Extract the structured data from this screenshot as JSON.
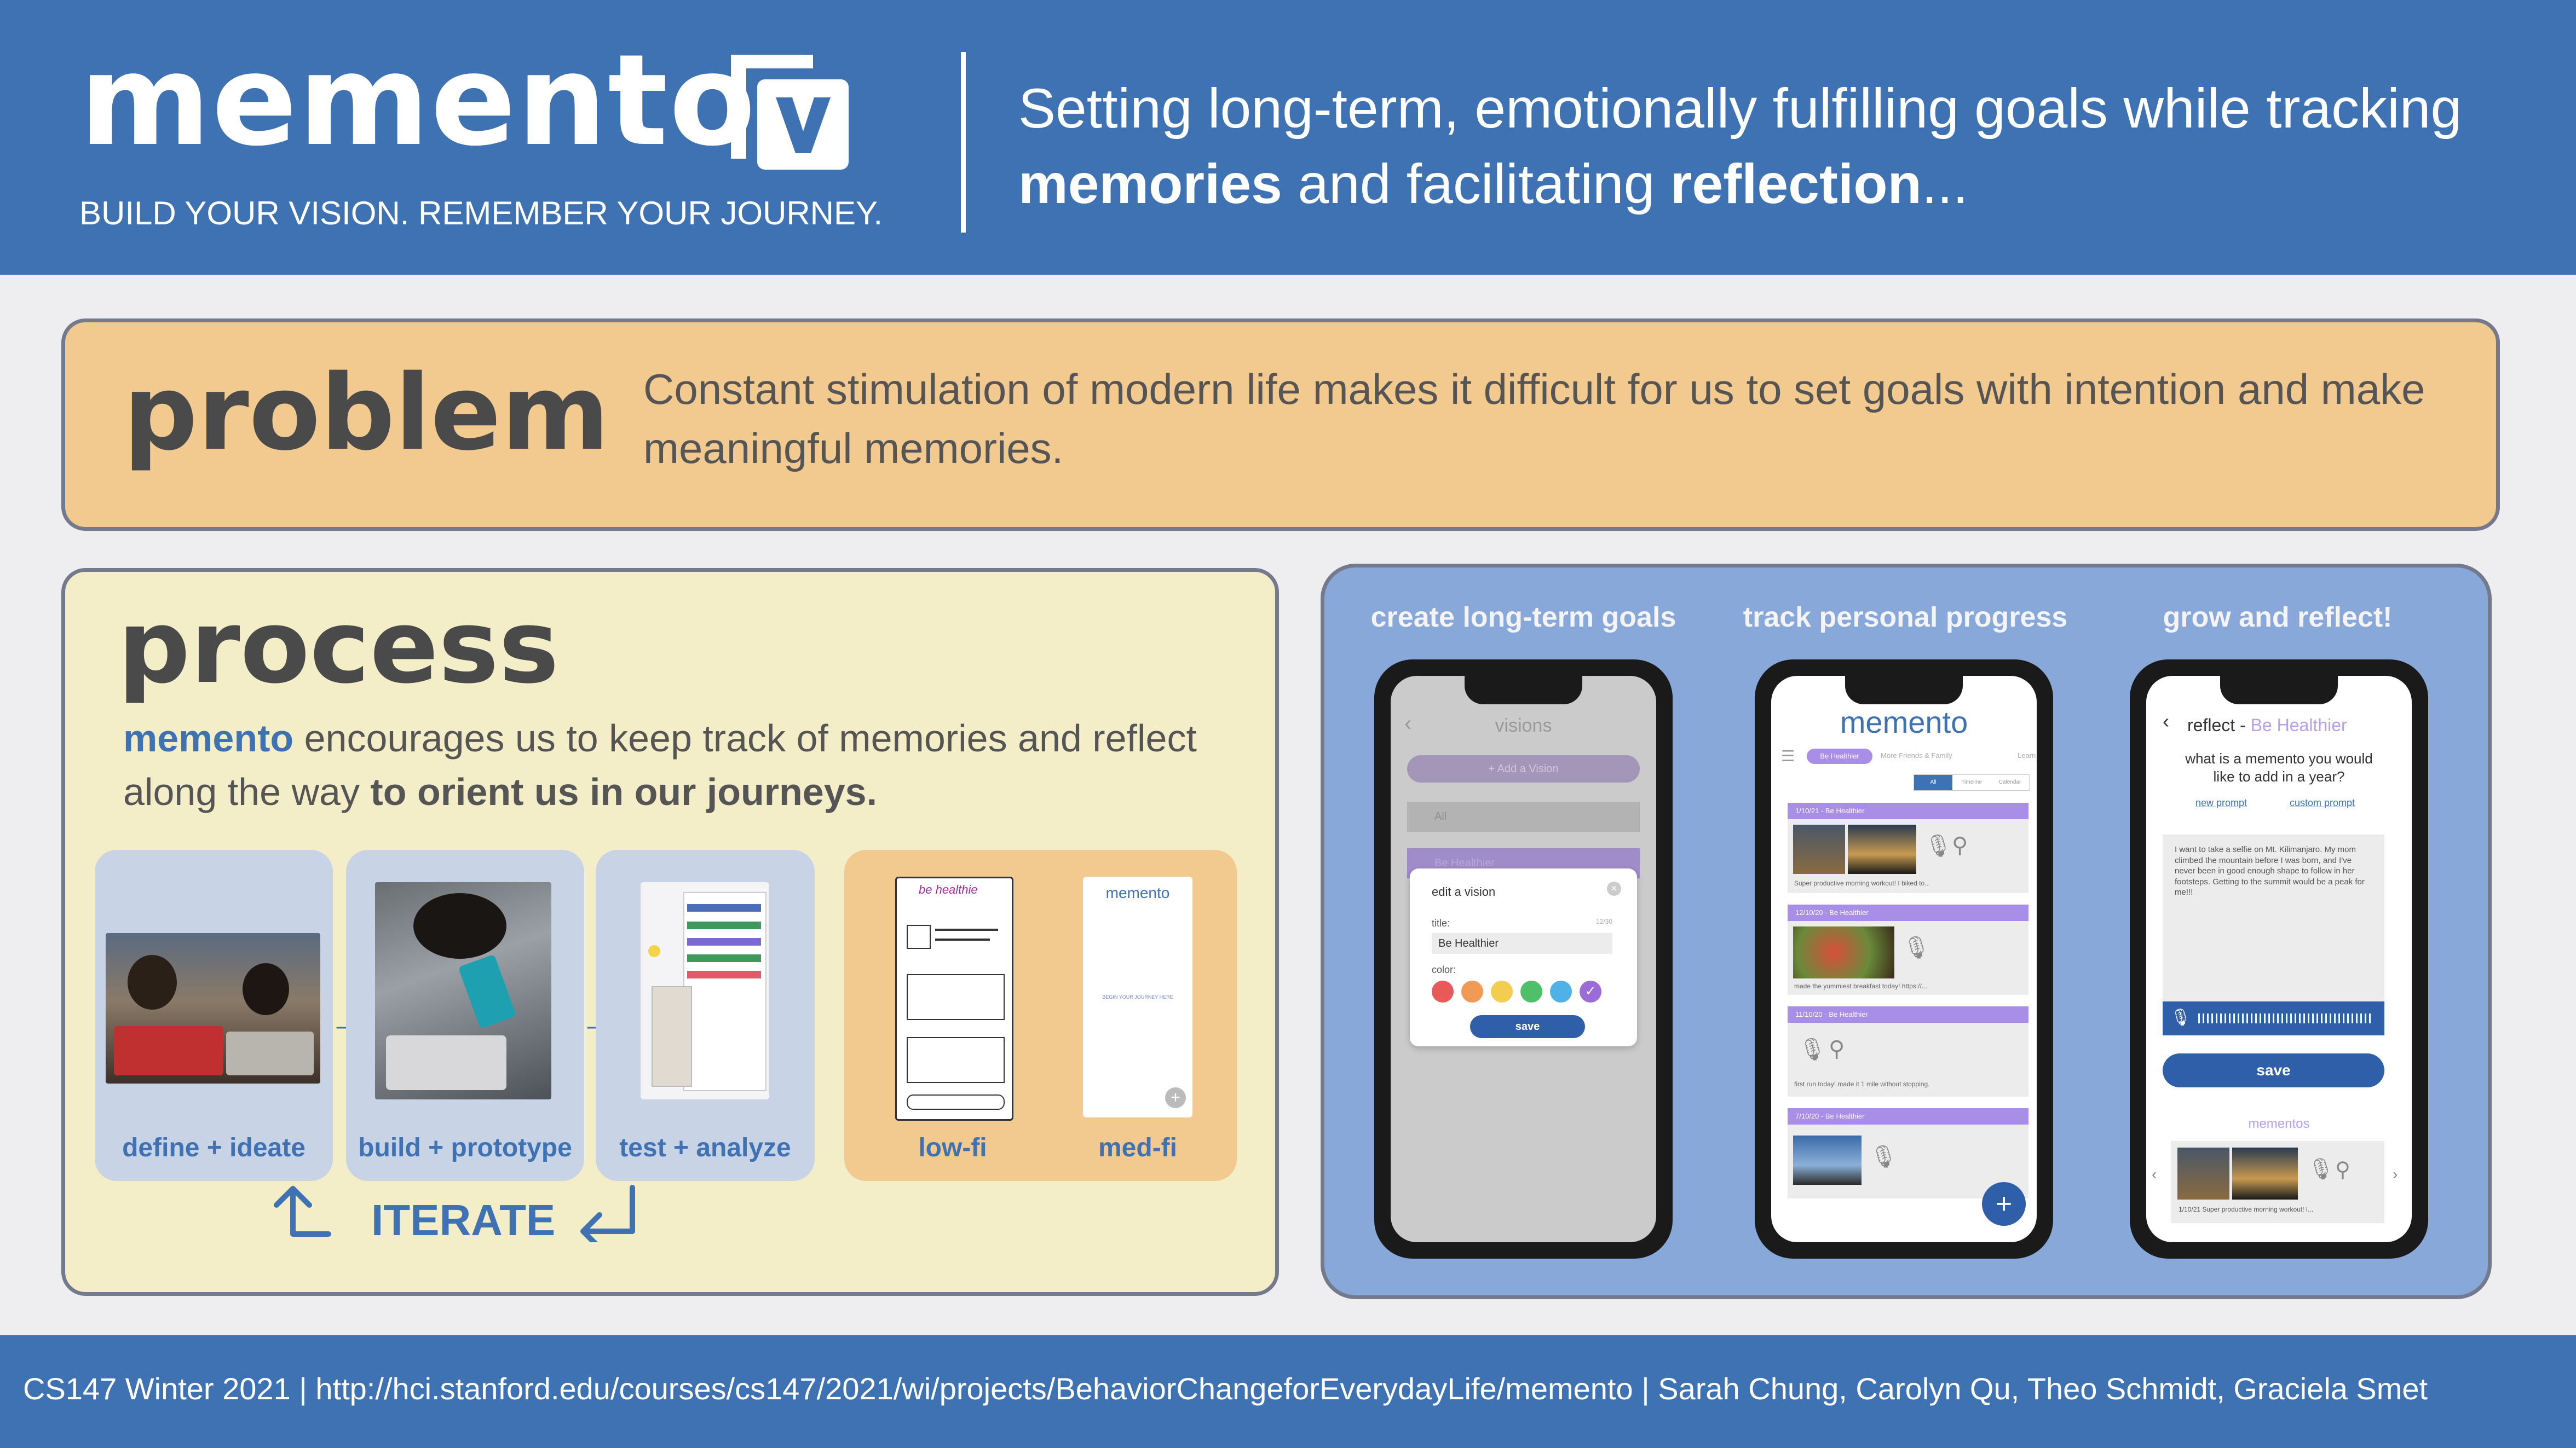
{
  "header": {
    "title": "memento",
    "tagline": "BUILD YOUR VISION. REMEMBER YOUR JOURNEY.",
    "pitch_1": "Setting long-term, emotionally fulfilling goals while tracking",
    "pitch_bold_1": "memories",
    "pitch_2": " and facilitating ",
    "pitch_bold_2": "reflection",
    "pitch_3": "..."
  },
  "problem": {
    "title": "problem",
    "text": "Constant stimulation of modern life makes it difficult for us to set goals with intention and make meaningful memories."
  },
  "process": {
    "title": "process",
    "desc_brand": "memento",
    "desc_1": " encourages us to keep track of memories and reflect along the way ",
    "desc_bold": "to orient us in our journeys.",
    "steps": [
      {
        "label": "define + ideate"
      },
      {
        "label": "build + prototype"
      },
      {
        "label": "test + analyze"
      }
    ],
    "fidelity": [
      {
        "label": "low-fi"
      },
      {
        "label": "med-fi"
      }
    ],
    "lowfi_title": "be healthie",
    "medfi_title": "memento",
    "medfi_text": "BEGIN YOUR JOURNEY HERE",
    "iterate": "ITERATE"
  },
  "screens": {
    "captions": [
      "create long-term goals",
      "track personal progress",
      "grow and reflect!"
    ],
    "screen1": {
      "header": "visions",
      "add_button": "+ Add a Vision",
      "item_all": "All",
      "item_healthier": "Be Healthier",
      "dialog_title": "edit a vision",
      "field_label": "title:",
      "field_value": "Be Healthier",
      "field_count": "12/30",
      "color_label": "color:",
      "save": "save",
      "swatches": [
        "#e85a5a",
        "#f09a55",
        "#f2cd4f",
        "#4fbf6a",
        "#4fb1e8",
        "#9b6bd8"
      ]
    },
    "screen2": {
      "title": "memento",
      "chips": [
        "Be Healthier",
        "More Friends & Family",
        "Learn"
      ],
      "toggle": [
        "All",
        "Timeline",
        "Calendar"
      ],
      "entries": [
        {
          "header": "1/10/21 - Be Healthier",
          "text": "Super productive morning workout! I biked to..."
        },
        {
          "header": "12/10/20 - Be Healthier",
          "text": "made the yummiest breakfast today! https://..."
        },
        {
          "header": "11/10/20 - Be Healthier",
          "text": "first run today! made it 1 mile without stopping."
        },
        {
          "header": "7/10/20 - Be Healthier",
          "text": ""
        }
      ],
      "fab": "+"
    },
    "screen3": {
      "header": "reflect - ",
      "header_accent": "Be Healthier",
      "question": "what is a memento you would like to add in a year?",
      "link_1": "new prompt",
      "link_2": "custom prompt",
      "entry": "I want to take a selfie on Mt. Kilimanjaro. My mom climbed the mountain before I was born, and I've never been in good enough shape to follow in her footsteps. Getting to the summit would be a peak for me!!!",
      "save": "save",
      "mementos_label": "mementos",
      "memento_caption": "1/10/21 Super productive morning workout! I..."
    }
  },
  "footer": {
    "text": "CS147 Winter 2021 | http://hci.stanford.edu/courses/cs147/2021/wi/projects/BehaviorChangeforEverydayLife/memento | Sarah Chung, Carolyn Qu, Theo Schmidt, Graciela Smet"
  },
  "colors": {
    "brand_blue": "#3e72b3",
    "problem_bg": "#f2c98e",
    "process_bg": "#f4eec8",
    "screens_bg": "#87a8d8",
    "accent_purple": "#b4a0ee"
  }
}
